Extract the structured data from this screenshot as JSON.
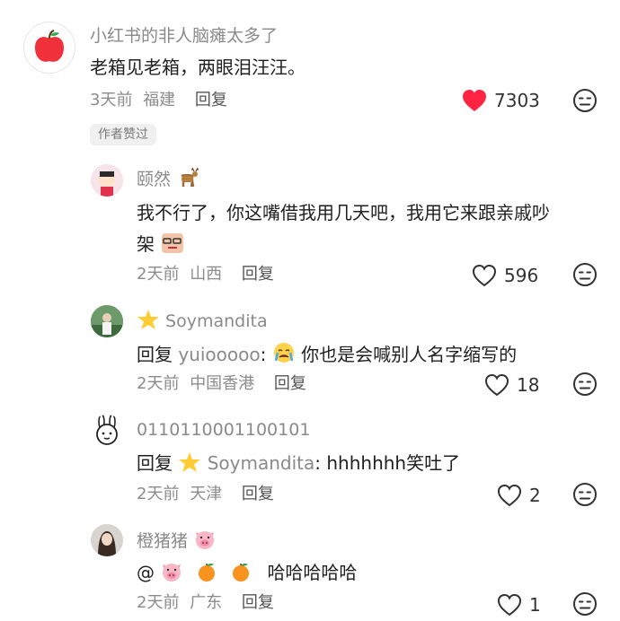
{
  "comments": [
    {
      "username": "小红书的非人脑瘫太多了",
      "text": "老箱见老箱，两眼泪汪汪。",
      "time": "3天前",
      "location": "福建",
      "reply_label": "回复",
      "likes": "7303",
      "liked": true,
      "badge": "作者赞过",
      "avatar_icon": "apple-icon"
    },
    {
      "username": "颐然",
      "username_emoji": "deer-icon",
      "text_line1": "我不行了，你这嘴借我用几天吧，我用它来跟亲戚吵",
      "text_line2": "架",
      "text_emoji": "sticker-icon",
      "time": "2天前",
      "location": "山西",
      "reply_label": "回复",
      "likes": "596"
    },
    {
      "username": "Soymandita",
      "username_emoji": "star-icon",
      "reply_prefix": "回复",
      "reply_to": "yuiooooo",
      "text": "你也是会喊别人名字缩写的",
      "text_emoji": "crying-face-icon",
      "time": "2天前",
      "location": "中国香港",
      "reply_label": "回复",
      "likes": "18"
    },
    {
      "username": "0110110001100101",
      "reply_prefix": "回复",
      "reply_to": "Soymandita",
      "text": "hhhhhhh笑吐了",
      "time": "2天前",
      "location": "天津",
      "reply_label": "回复",
      "likes": "2",
      "avatar_icon": "rabbit-icon"
    },
    {
      "username": "橙猪猪",
      "username_emoji": "pig-icon",
      "mention": "@",
      "text": "哈哈哈哈哈",
      "time": "2天前",
      "location": "广东",
      "reply_label": "回复",
      "likes": "1"
    }
  ],
  "colors": {
    "liked_red": "#ff2442",
    "meta_gray": "#8c8c8c",
    "icon_gray": "#333333"
  }
}
